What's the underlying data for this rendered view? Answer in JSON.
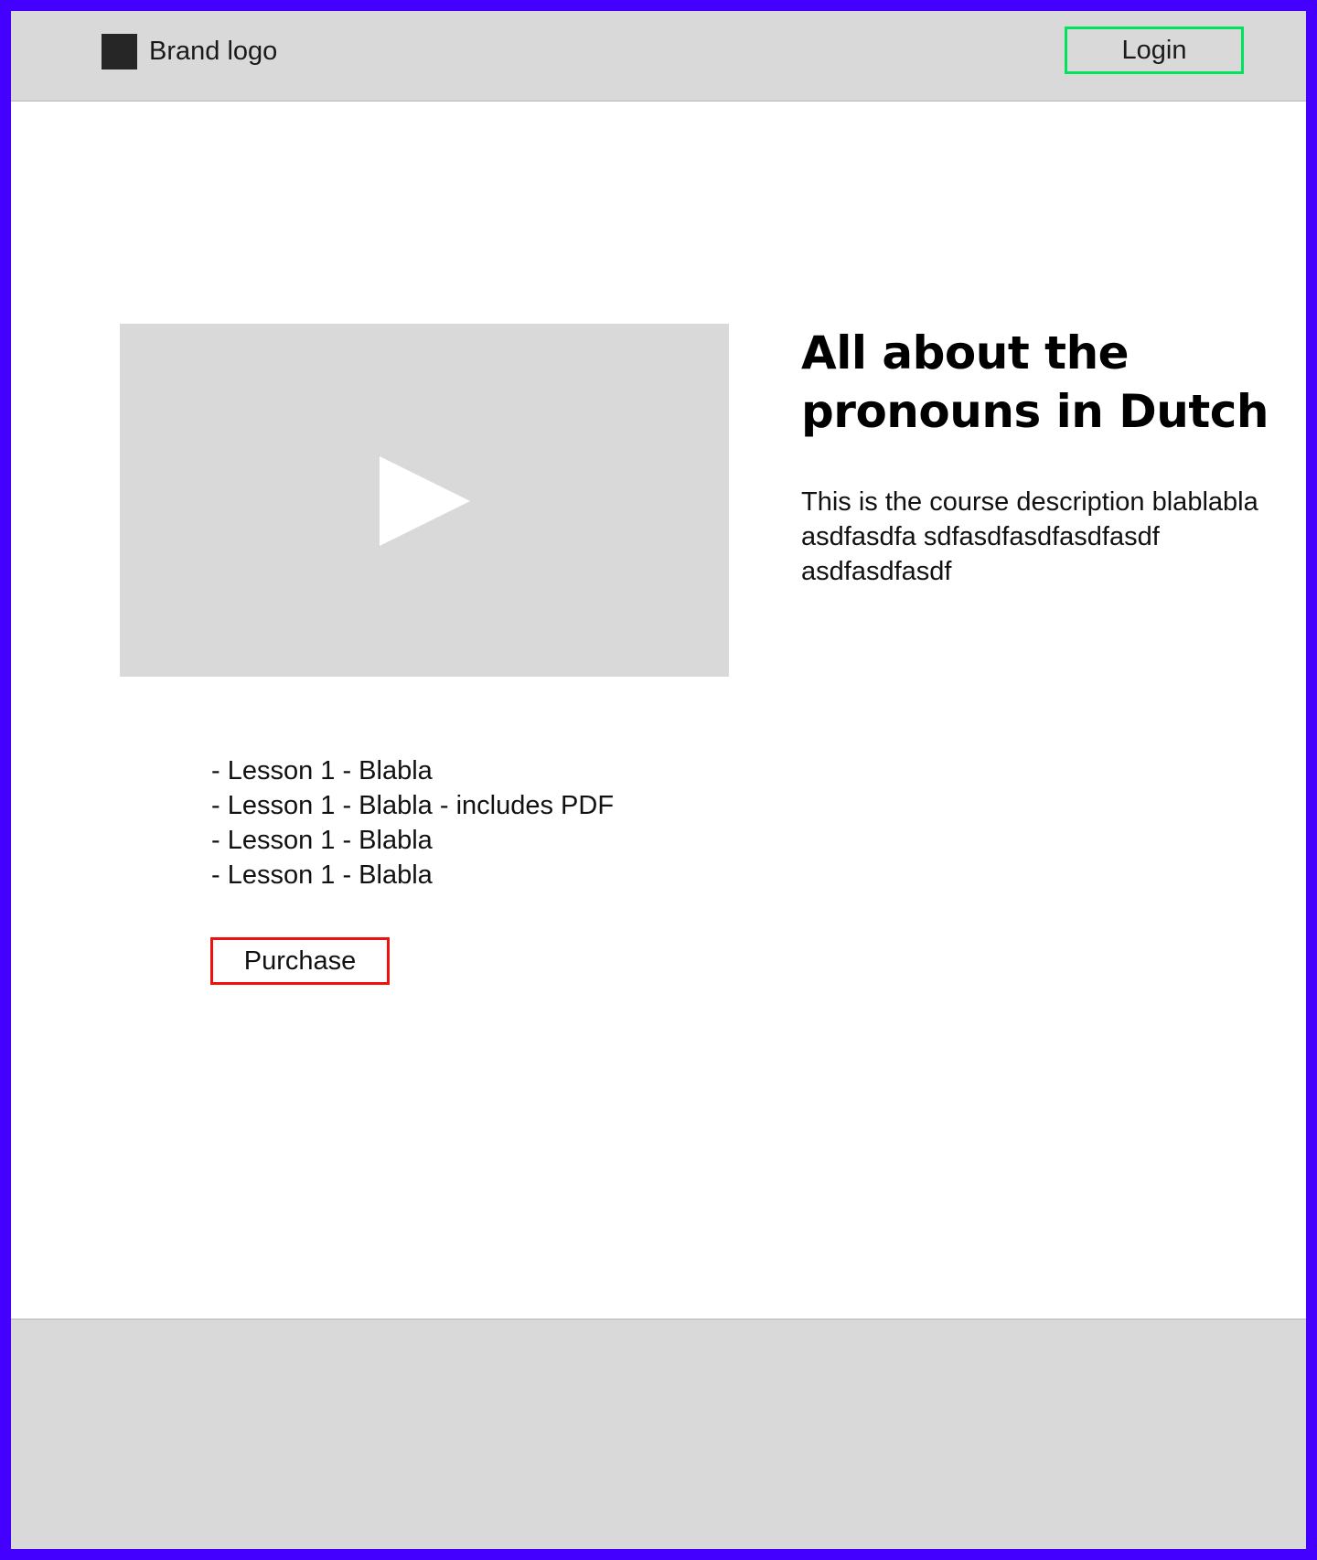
{
  "header": {
    "brand_logo_text": "Brand logo",
    "login_label": "Login"
  },
  "video": {
    "icon": "play-icon"
  },
  "course": {
    "title": "All about the pronouns in Dutch",
    "description": "This is the course description blablabla asdfasdfa sdfasdfasdfasdfasdf asdfasdfasdf"
  },
  "lessons": [
    "- Lesson 1 - Blabla",
    "- Lesson 1 - Blabla - includes PDF",
    "- Lesson 1 - Blabla",
    "- Lesson 1 - Blabla"
  ],
  "purchase_label": "Purchase",
  "colors": {
    "frame": "#4400ff",
    "panel_gray": "#d9d9d9",
    "login_border": "#00e35c",
    "purchase_border": "#ee1111",
    "logo_mark": "#262626"
  }
}
